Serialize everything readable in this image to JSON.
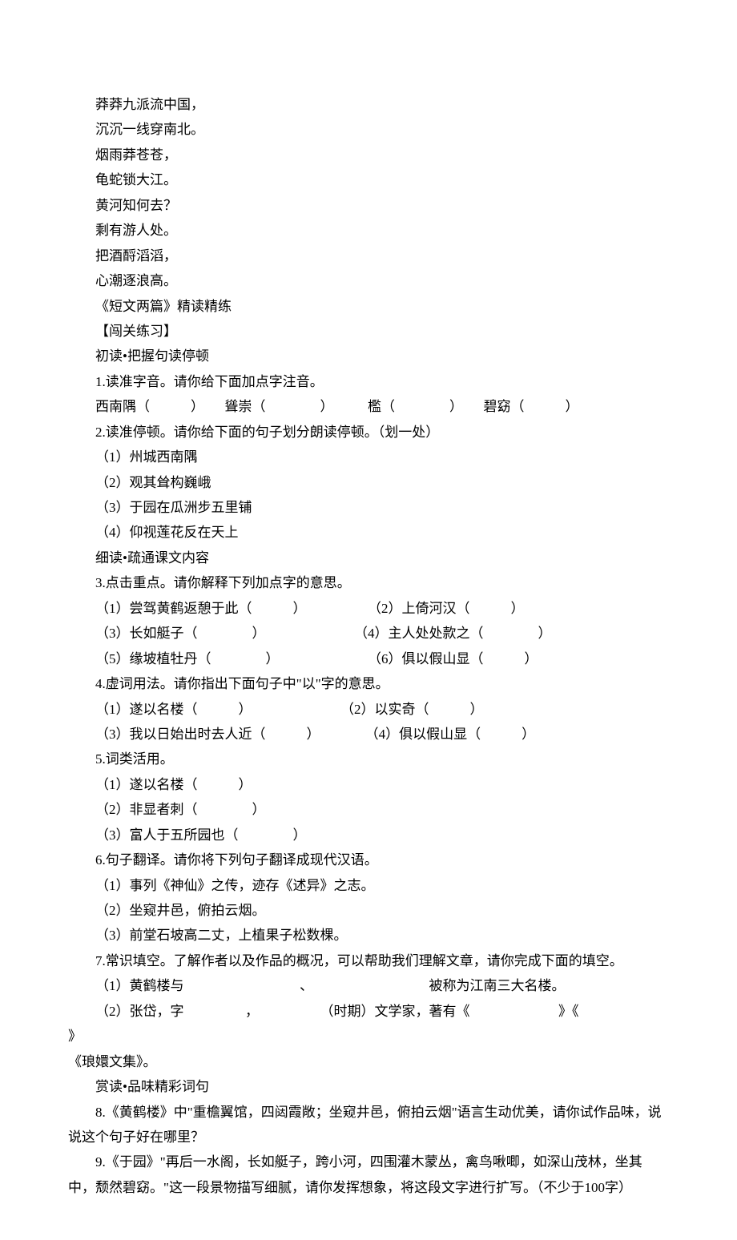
{
  "poem": {
    "lines": [
      "莽莽九派流中国，",
      "沉沉一线穿南北。",
      "烟雨莽苍苍，",
      "龟蛇锁大江。",
      "黄河知何去？",
      "剩有游人处。",
      "把酒酹滔滔，",
      "心潮逐浪高。"
    ]
  },
  "doc_title": "《短文两篇》精读精练",
  "gate_title": "【闯关练习】",
  "sec1": {
    "heading": "初读•把握句读停顿",
    "q1": {
      "stem": "1.读准字音。请你给下面加点字注音。",
      "items_line": "西南隅（　　　）　　聳崇（　　　　）　　　檻（　　　　）　　碧窈（　　　）"
    },
    "q2": {
      "stem": "2.读准停顿。请你给下面的句子划分朗读停顿。（划一处）",
      "items": [
        "（1）州城西南隅",
        "（2）观其耸构巍峨",
        "（3）于园在瓜洲步五里铺",
        "（4）仰视莲花反在天上"
      ]
    }
  },
  "sec2": {
    "heading": "细读•疏通课文内容",
    "q3": {
      "stem": "3.点击重点。请你解释下列加点字的意思。",
      "pairs": [
        {
          "l": "（1）尝驾黄鹤返憩于此（　　　）",
          "r": "（2）上倚河汉（　　　）"
        },
        {
          "l": "（3）长如艇子（　　　　）",
          "r": "（4）主人处处款之（　　　　）"
        },
        {
          "l": "（5）缘坡植牡丹（　　　　）",
          "r": "（6）俱以假山显（　　　）"
        }
      ]
    },
    "q4": {
      "stem": "4.虚词用法。请你指出下面句子中\"以\"字的意思。",
      "pairs": [
        {
          "l": "（1）遂以名楼（　　　）",
          "r": "（2）以实奇（　　　）"
        },
        {
          "l": "（3）我以日始出时去人近（　　　）",
          "r": "（4）俱以假山显（　　　）"
        }
      ]
    },
    "q5": {
      "stem": "5.词类活用。",
      "items": [
        "（1）遂以名楼（　　　）",
        "（2）非显者刺（　　　　）",
        "（3）富人于五所园也（　　　　）"
      ]
    },
    "q6": {
      "stem": "6.句子翻译。请你将下列句子翻译成现代汉语。",
      "items": [
        "（1）事列《神仙》之传，迹存《述异》之志。",
        "（2）坐窥井邑，俯拍云烟。",
        "（3）前堂石坡高二丈，上植果子松数棵。"
      ]
    },
    "q7": {
      "stem": "7.常识填空。了解作者以及作品的概况，可以帮助我们理解文章，请你完成下面的填空。",
      "item1_a": "（1）黄鹤楼与",
      "item1_b": "、",
      "item1_c": "被称为江南三大名楼。",
      "item2_a": "（2）张岱，字",
      "item2_b": "，",
      "item2_c": "（时期）文学家，著有《",
      "item2_d": "》《",
      "item2_e": "》",
      "item2_tail": "《琅嬛文集》。"
    }
  },
  "sec3": {
    "heading": "赏读•品味精彩词句",
    "q8": "8.《黄鹤楼》中\"重檐翼馆，四闼霞敞；坐窥井邑，俯拍云烟\"语言生动优美，请你试作品味，说说这个句子好在哪里？",
    "q9": "9.《于园》\"再后一水阁，长如艇子，跨小河，四围灌木蒙丛，禽鸟啾唧，如深山茂林，坐其中，颓然碧窈。\"这一段景物描写细腻，请你发挥想象，将这段文字进行扩写。（不少于100字）"
  }
}
